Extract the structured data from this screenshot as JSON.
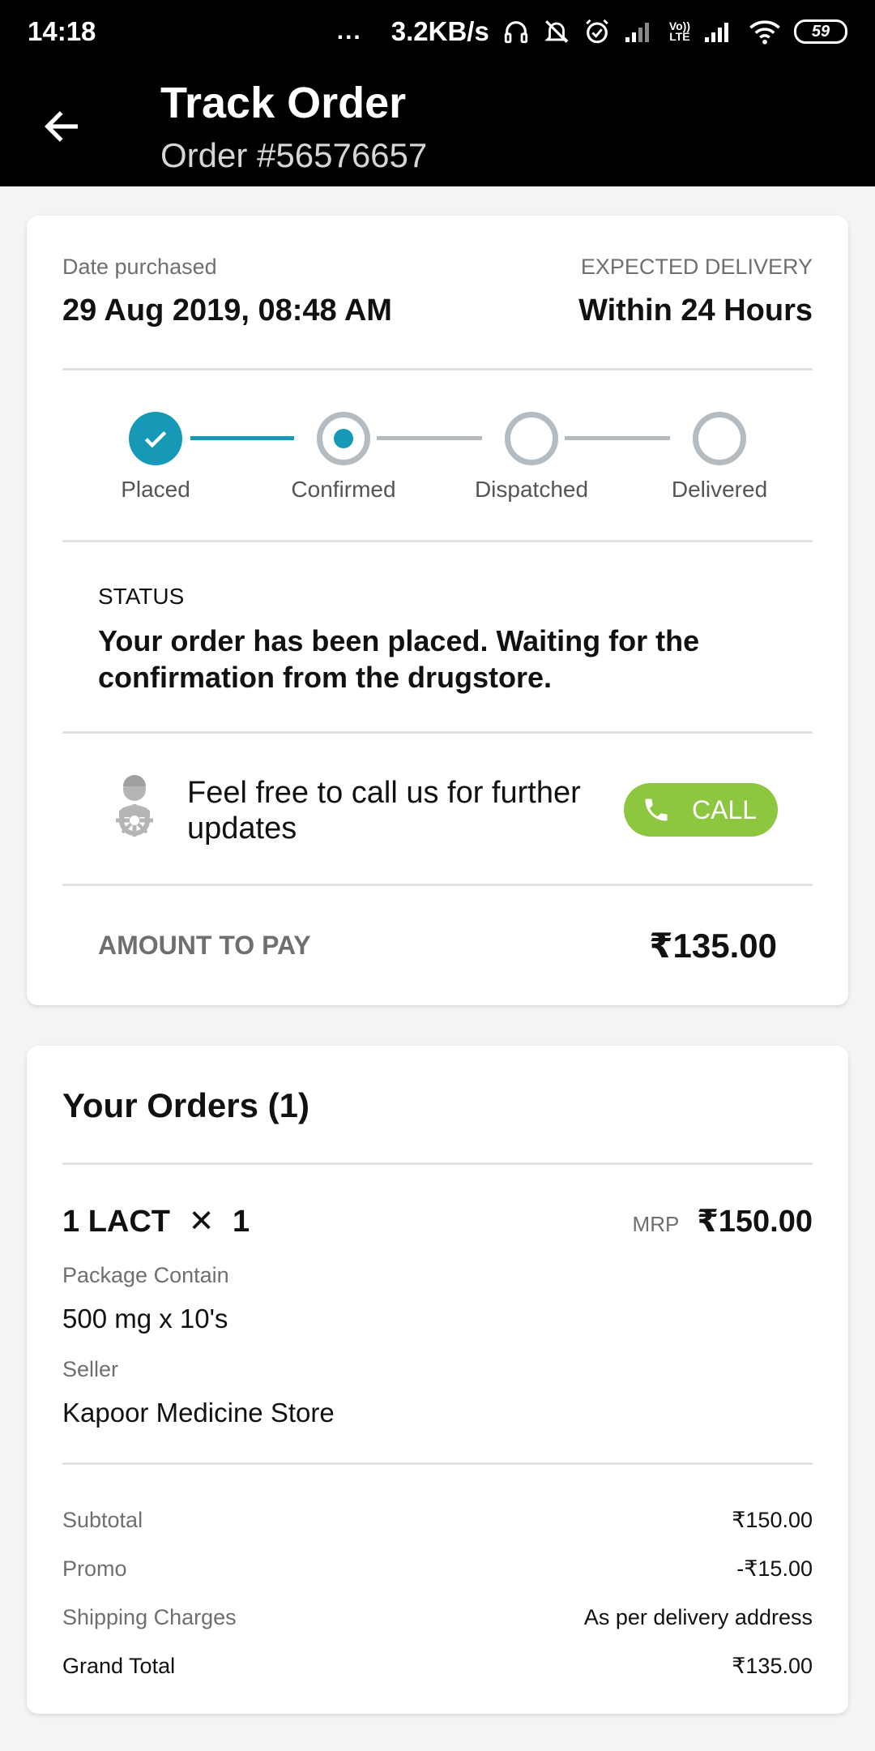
{
  "status_bar": {
    "time": "14:18",
    "dots": "...",
    "net_speed": "3.2KB/s",
    "volte_top": "Vo))",
    "volte_bottom": "LTE",
    "battery": "59",
    "icons": [
      "headphones-icon",
      "mute-icon",
      "alarm-icon",
      "signal-icon",
      "volte-icon",
      "signal-icon",
      "wifi-icon",
      "battery-icon"
    ]
  },
  "app_bar": {
    "title": "Track Order",
    "subtitle": "Order #56576657"
  },
  "summary": {
    "date_label": "Date purchased",
    "date_value": "29 Aug 2019, 08:48 AM",
    "delivery_label": "EXPECTED DELIVERY",
    "delivery_value": "Within 24 Hours"
  },
  "tracker": {
    "steps": [
      {
        "label": "Placed",
        "state": "done"
      },
      {
        "label": "Confirmed",
        "state": "active"
      },
      {
        "label": "Dispatched",
        "state": "pending"
      },
      {
        "label": "Delivered",
        "state": "pending"
      }
    ]
  },
  "status": {
    "heading": "STATUS",
    "message": "Your order has been placed. Waiting for the confirmation from the drugstore."
  },
  "support": {
    "line1": "Feel free to call us for further",
    "line2": "updates",
    "call_label": "CALL"
  },
  "amount": {
    "label": "AMOUNT TO PAY",
    "value": "₹135.00"
  },
  "orders": {
    "title": "Your Orders (1)",
    "items": [
      {
        "name": "1 LACT",
        "times": "✕",
        "qty": "1",
        "mrp_label": "MRP",
        "mrp": "₹150.00",
        "package_label": "Package Contain",
        "package_value": "500 mg x 10's",
        "seller_label": "Seller",
        "seller_value": "Kapoor Medicine Store"
      }
    ]
  },
  "totals": [
    {
      "label": "Subtotal",
      "value": "₹150.00"
    },
    {
      "label": "Promo",
      "value": "-₹15.00"
    },
    {
      "label": "Shipping Charges",
      "value": "As per delivery address"
    },
    {
      "label": "Grand Total",
      "value": "₹135.00"
    }
  ],
  "colors": {
    "accent": "#1698b7",
    "call_button": "#8dc63f",
    "header_bg": "#000000"
  }
}
